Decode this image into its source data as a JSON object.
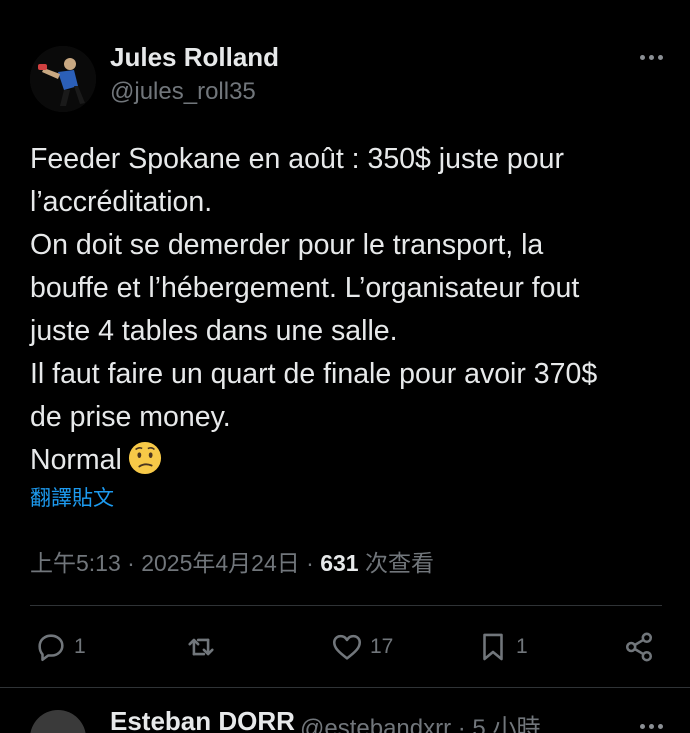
{
  "post": {
    "author_name": "Jules Rolland",
    "author_handle": "@jules_roll35",
    "text_lines": [
      "Feeder Spokane en août : 350$ juste pour",
      "l’accréditation.",
      "On doit se demerder pour le transport, la",
      "bouffe et l’hébergement. L’organisateur fout",
      "juste 4 tables dans une salle.",
      "Il faut faire un quart de finale pour avoir 370$",
      "de prise money.",
      "Normal"
    ],
    "emoji": "confused-face-icon",
    "translate_label": "翻譯貼文",
    "timestamp": "上午5:13 · 2025年4月24日 · ",
    "views_count": "631",
    "views_label": " 次查看"
  },
  "actions": {
    "reply_count": "1",
    "retweet_count": "",
    "like_count": "17",
    "bookmark_count": "1"
  },
  "next_post": {
    "author_name": "Esteban DORR",
    "author_handle": "@estebandxrr · 5 小時"
  },
  "colors": {
    "background": "#000000",
    "text": "#e7e9ea",
    "secondary": "#71767b",
    "link": "#1d9bf0",
    "divider": "#2f3336"
  }
}
